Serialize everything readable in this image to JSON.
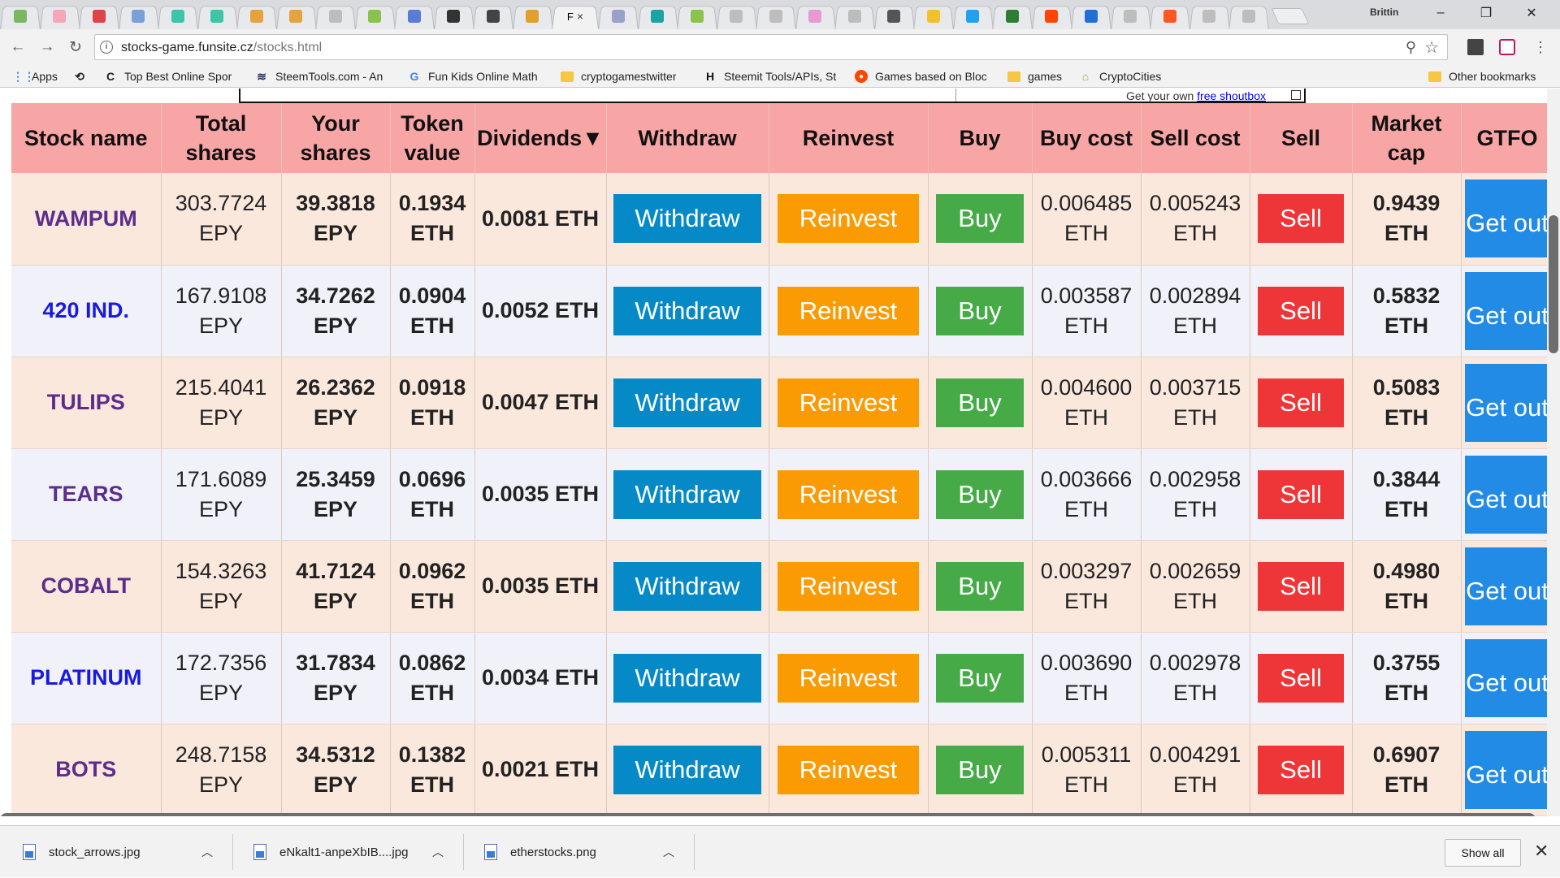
{
  "browser": {
    "profile_name": "Brittin",
    "active_tab_label": "F",
    "tab_icon_colors": [
      "#7bb661",
      "#f4a7b9",
      "#e04343",
      "#7aa0d8",
      "#3cc6a5",
      "#3cc6a5",
      "#e6a23c",
      "#e6a23c",
      "#bdbdbd",
      "#8bc34a",
      "#5a7bd6",
      "#333333",
      "#444444",
      "#e0a02a",
      "#ffffff",
      "#9aa0c8",
      "#1aa3a3",
      "#8bc34a",
      "#bdbdbd",
      "#bdbdbd",
      "#e69ad0",
      "#bdbdbd",
      "#555555",
      "#f3c12b",
      "#1da1f2",
      "#2e7d32",
      "#ff4500",
      "#1f6fd6",
      "#bdbdbd",
      "#ff5722",
      "#bdbdbd",
      "#bdbdbd"
    ],
    "url_host": "stocks-game.funsite.cz",
    "url_path": "/stocks.html",
    "window_controls": {
      "minimize": "–",
      "maximize": "❐",
      "close": "✕"
    },
    "nav": {
      "back": "←",
      "forward": "→",
      "reload": "↻"
    }
  },
  "bookmarks": [
    {
      "label": "Apps",
      "icon": "apps-grid-icon"
    },
    {
      "label": "",
      "icon": "history-icon"
    },
    {
      "label": "Top Best Online Spor",
      "icon": "c-logo-icon"
    },
    {
      "label": "SteemTools.com - An",
      "icon": "steem-icon"
    },
    {
      "label": "Fun Kids Online Math",
      "icon": "google-icon"
    },
    {
      "label": "cryptogamestwitter",
      "icon": "folder-icon"
    },
    {
      "label": "Steemit Tools/APIs, St",
      "icon": "h-icon"
    },
    {
      "label": "Games based on Bloc",
      "icon": "reddit-icon"
    },
    {
      "label": "games",
      "icon": "folder-icon"
    },
    {
      "label": "CryptoCities",
      "icon": "cryptocities-icon"
    },
    {
      "label": "Other bookmarks",
      "icon": "folder-icon"
    }
  ],
  "shoutbox": {
    "text_prefix": "Get your own ",
    "link_text": "free shoutbox"
  },
  "table": {
    "headers": {
      "name": "Stock name",
      "total": "Total shares",
      "yours": "Your shares",
      "token": "Token value",
      "dividends": "Dividends▼",
      "withdraw": "Withdraw",
      "reinvest": "Reinvest",
      "buy": "Buy",
      "buycost": "Buy cost",
      "sellcost": "Sell cost",
      "sell": "Sell",
      "mcap": "Market cap",
      "gtfo": "GTFO"
    },
    "button_labels": {
      "withdraw": "Withdraw",
      "reinvest": "Reinvest",
      "buy": "Buy",
      "sell": "Sell",
      "getout": "Get out"
    },
    "rows": [
      {
        "name": "WAMPUM",
        "name_color": "#5b2d8c",
        "total": "303.7724 EPY",
        "yours": "39.3818 EPY",
        "token": "0.1934 ETH",
        "dividends": "0.0081 ETH",
        "buycost": "0.006485 ETH",
        "sellcost": "0.005243 ETH",
        "mcap": "0.9439 ETH"
      },
      {
        "name": "420 IND.",
        "name_color": "#1a1adf",
        "total": "167.9108 EPY",
        "yours": "34.7262 EPY",
        "token": "0.0904 ETH",
        "dividends": "0.0052 ETH",
        "buycost": "0.003587 ETH",
        "sellcost": "0.002894 ETH",
        "mcap": "0.5832 ETH"
      },
      {
        "name": "TULIPS",
        "name_color": "#5b2d8c",
        "total": "215.4041 EPY",
        "yours": "26.2362 EPY",
        "token": "0.0918 ETH",
        "dividends": "0.0047 ETH",
        "buycost": "0.004600 ETH",
        "sellcost": "0.003715 ETH",
        "mcap": "0.5083 ETH"
      },
      {
        "name": "TEARS",
        "name_color": "#5b2d8c",
        "total": "171.6089 EPY",
        "yours": "25.3459 EPY",
        "token": "0.0696 ETH",
        "dividends": "0.0035 ETH",
        "buycost": "0.003666 ETH",
        "sellcost": "0.002958 ETH",
        "mcap": "0.3844 ETH"
      },
      {
        "name": "COBALT",
        "name_color": "#5b2d8c",
        "total": "154.3263 EPY",
        "yours": "41.7124 EPY",
        "token": "0.0962 ETH",
        "dividends": "0.0035 ETH",
        "buycost": "0.003297 ETH",
        "sellcost": "0.002659 ETH",
        "mcap": "0.4980 ETH"
      },
      {
        "name": "PLATINUM",
        "name_color": "#1a1adf",
        "total": "172.7356 EPY",
        "yours": "31.7834 EPY",
        "token": "0.0862 ETH",
        "dividends": "0.0034 ETH",
        "buycost": "0.003690 ETH",
        "sellcost": "0.002978 ETH",
        "mcap": "0.3755 ETH"
      },
      {
        "name": "BOTS",
        "name_color": "#5b2d8c",
        "total": "248.7158 EPY",
        "yours": "34.5312 EPY",
        "token": "0.1382 ETH",
        "dividends": "0.0021 ETH",
        "buycost": "0.005311 ETH",
        "sellcost": "0.004291 ETH",
        "mcap": "0.6907 ETH"
      }
    ]
  },
  "downloads": {
    "files": [
      "stock_arrows.jpg",
      "eNkalt1-anpeXbIB....jpg",
      "etherstocks.png"
    ],
    "show_all": "Show all"
  },
  "colors": {
    "header_bg": "#f8a5a5",
    "row_odd": "#fbe8dc",
    "row_even": "#f1f2f9",
    "withdraw": "#0589c7",
    "reinvest": "#fb9b04",
    "buy": "#46ab47",
    "sell": "#ee3538",
    "getout": "#218be6",
    "market_cap_text": "#5b2d8c"
  }
}
